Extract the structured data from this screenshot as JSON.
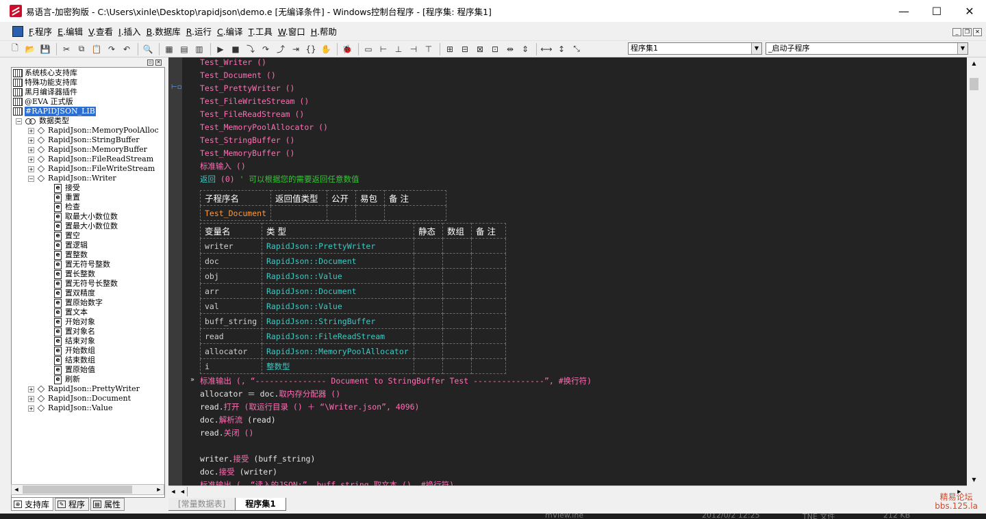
{
  "window": {
    "title": "易语言-加密狗版 - C:\\Users\\xinle\\Desktop\\rapidjson\\demo.e [无编译条件] - Windows控制台程序 - [程序集: 程序集1]",
    "controls": {
      "minimize": "—",
      "maximize": "☐",
      "close": "✕"
    }
  },
  "menu": [
    {
      "key": "F",
      "label": ".程序"
    },
    {
      "key": "E",
      "label": ".编辑"
    },
    {
      "key": "V",
      "label": ".查看"
    },
    {
      "key": "I",
      "label": ".插入"
    },
    {
      "key": "B",
      "label": ".数据库"
    },
    {
      "key": "R",
      "label": ".运行"
    },
    {
      "key": "C",
      "label": ".编译"
    },
    {
      "key": "T",
      "label": ".工具"
    },
    {
      "key": "W",
      "label": ".窗口"
    },
    {
      "key": "H",
      "label": ".帮助"
    }
  ],
  "toolbar": {
    "assembly_combo": "程序集1",
    "sub_combo": "_启动子程序"
  },
  "tree": {
    "libraries": [
      "系统核心支持库",
      "特殊功能支持库",
      "黑月编译器插件",
      "@EVA 正式版",
      "#RAPIDJSON_LIB"
    ],
    "datatypes_label": "数据类型",
    "classes_before": [
      "RapidJson::MemoryPoolAlloc",
      "RapidJson::StringBuffer",
      "RapidJson::MemoryBuffer",
      "RapidJson::FileReadStream",
      "RapidJson::FileWriteStream"
    ],
    "writer_class": "RapidJson::Writer",
    "writer_methods": [
      "接受",
      "重置",
      "检查",
      "取最大小数位数",
      "置最大小数位数",
      "置空",
      "置逻辑",
      "置整数",
      "置无符号整数",
      "置长整数",
      "置无符号长整数",
      "置双精度",
      "置原始数字",
      "置文本",
      "开始对象",
      "置对象名",
      "结束对象",
      "开始数组",
      "结束数组",
      "置原始值",
      "刷新"
    ],
    "classes_after": [
      "RapidJson::PrettyWriter",
      "RapidJson::Document",
      "RapidJson::Value"
    ]
  },
  "left_tabs": [
    "支持库",
    "程序",
    "属性"
  ],
  "code": {
    "calls": [
      "Test_Writer ()",
      "Test_Document ()",
      "Test_PrettyWriter ()",
      "Test_FileWriteStream ()",
      "Test_FileReadStream ()",
      "Test_MemoryPoolAllocator ()",
      "Test_StringBuffer ()",
      "Test_MemoryBuffer ()"
    ],
    "std_input": "标准输入 ()",
    "return_kw": "返回",
    "return_args": " (0) ",
    "return_comment": "' 可以根据您的需要返回任意数值",
    "sub_table": {
      "headers": [
        "子程序名",
        "返回值类型",
        "公开",
        "易包",
        "备 注"
      ],
      "name": "Test_Document"
    },
    "var_table": {
      "headers": [
        "变量名",
        "类 型",
        "静态",
        "数组",
        "备 注"
      ],
      "rows": [
        {
          "name": "writer",
          "type": "RapidJson::PrettyWriter"
        },
        {
          "name": "doc",
          "type": "RapidJson::Document"
        },
        {
          "name": "obj",
          "type": "RapidJson::Value"
        },
        {
          "name": "arr",
          "type": "RapidJson::Document"
        },
        {
          "name": "val",
          "type": "RapidJson::Value"
        },
        {
          "name": "buff_string",
          "type": "RapidJson::StringBuffer"
        },
        {
          "name": "read",
          "type": "RapidJson::FileReadStream"
        },
        {
          "name": "allocator",
          "type": "RapidJson::MemoryPoolAllocator"
        },
        {
          "name": "i",
          "type": "整数型"
        }
      ]
    },
    "line1": "标准输出 (, “--------------- Document to StringBuffer Test ---------------”, #换行符)",
    "line2a": "allocator ＝ doc.",
    "line2b": "取内存分配器 ()",
    "line3a": "read.",
    "line3b": "打开 (取运行目录 () ＋ “\\Writer.json”, 4096)",
    "line4a": "doc.",
    "line4b": "解析流",
    "line4c": " (read)",
    "line5a": "read.",
    "line5b": "关闭 ()",
    "line6a": "writer.",
    "line6b": "接受",
    "line6c": " (buff_string)",
    "line7a": "doc.",
    "line7b": "接受",
    "line7c": " (writer)",
    "line8": "标准输出 (, “读入的JSON:”, buff_string.取文本 (), #换行符)"
  },
  "bottom_tabs": [
    "[常量数据表]",
    "程序集1"
  ],
  "watermark": {
    "line1": "精易论坛",
    "line2": "bbs.125.la"
  },
  "background_strip": [
    "mView.ine",
    "2012/0/2 12:25",
    "TNE 文件",
    "212 KB"
  ]
}
